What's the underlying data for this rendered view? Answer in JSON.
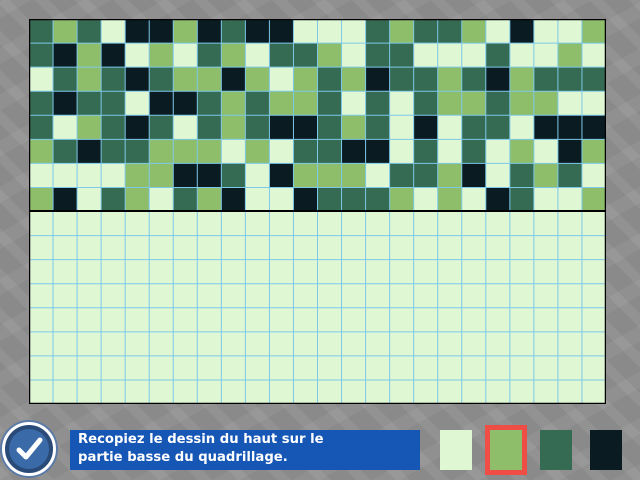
{
  "instruction": {
    "line1": "Recopiez le dessin du haut sur le",
    "line2": "partie basse du quadrillage."
  },
  "palette": [
    {
      "name": "light-green",
      "color": "#dff7d2",
      "selected": false
    },
    {
      "name": "green",
      "color": "#8ebe6a",
      "selected": true
    },
    {
      "name": "dark-green",
      "color": "#356b52",
      "selected": false
    },
    {
      "name": "black",
      "color": "#0a1c22",
      "selected": false
    }
  ],
  "colors": {
    "grid_line": "#7ec8ea",
    "empty_cell": "#dff7d2",
    "selection_outline": "#ef4e47",
    "divider": "#000000"
  },
  "grid": {
    "columns": 24,
    "rows": 16,
    "pattern_rows": [
      "DGDLKKGKDKKLLLDGDDGLKLLG",
      "DKGKLGLDGLDDGLDDLLLDLLGL",
      "LDGDKDGGKGLGDGKDDGDKGDDD",
      "DKDDLKKDGDGGDLDLDGGDGGLL",
      "DLGDKDLDGDKKDGDLKLDDLKKK",
      "GDKDDGGGLGLDDKKLDLDLGLKG",
      "LLLLGGKKDLKGGGLDDGKLDGDL",
      "GKLDGLDGKLLKDDDGLGLKDLLG"
    ],
    "code_colors": {
      "L": "#dff7d2",
      "G": "#8ebe6a",
      "D": "#356b52",
      "K": "#0a1c22"
    }
  }
}
